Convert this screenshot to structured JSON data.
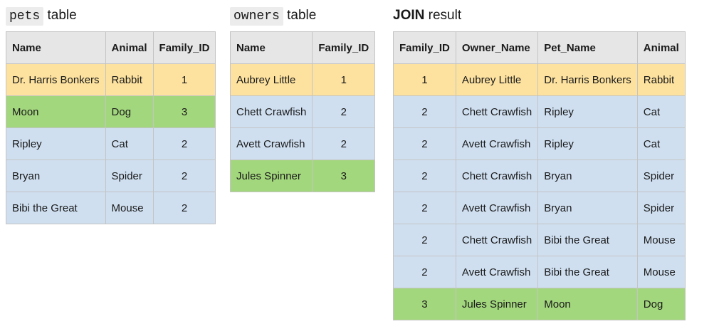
{
  "pets": {
    "title_code": "pets",
    "title_text": "table",
    "headers": [
      "Name",
      "Animal",
      "Family_ID"
    ],
    "rows": [
      {
        "color": "yellow",
        "cells": [
          "Dr. Harris Bonkers",
          "Rabbit",
          "1"
        ]
      },
      {
        "color": "green",
        "cells": [
          "Moon",
          "Dog",
          "3"
        ]
      },
      {
        "color": "blue",
        "cells": [
          "Ripley",
          "Cat",
          "2"
        ]
      },
      {
        "color": "blue",
        "cells": [
          "Bryan",
          "Spider",
          "2"
        ]
      },
      {
        "color": "blue",
        "cells": [
          "Bibi the Great",
          "Mouse",
          "2"
        ]
      }
    ]
  },
  "owners": {
    "title_code": "owners",
    "title_text": "table",
    "headers": [
      "Name",
      "Family_ID"
    ],
    "rows": [
      {
        "color": "yellow",
        "cells": [
          "Aubrey Little",
          "1"
        ]
      },
      {
        "color": "blue",
        "cells": [
          "Chett Crawfish",
          "2"
        ]
      },
      {
        "color": "blue",
        "cells": [
          "Avett Crawfish",
          "2"
        ]
      },
      {
        "color": "green",
        "cells": [
          "Jules Spinner",
          "3"
        ]
      }
    ]
  },
  "join": {
    "title_bold": "JOIN",
    "title_text": "result",
    "headers": [
      "Family_ID",
      "Owner_Name",
      "Pet_Name",
      "Animal"
    ],
    "rows": [
      {
        "color": "yellow",
        "cells": [
          "1",
          "Aubrey Little",
          "Dr. Harris Bonkers",
          "Rabbit"
        ]
      },
      {
        "color": "blue",
        "cells": [
          "2",
          "Chett Crawfish",
          "Ripley",
          "Cat"
        ]
      },
      {
        "color": "blue",
        "cells": [
          "2",
          "Avett Crawfish",
          "Ripley",
          "Cat"
        ]
      },
      {
        "color": "blue",
        "cells": [
          "2",
          "Chett Crawfish",
          "Bryan",
          "Spider"
        ]
      },
      {
        "color": "blue",
        "cells": [
          "2",
          "Avett Crawfish",
          "Bryan",
          "Spider"
        ]
      },
      {
        "color": "blue",
        "cells": [
          "2",
          "Chett Crawfish",
          "Bibi the Great",
          "Mouse"
        ]
      },
      {
        "color": "blue",
        "cells": [
          "2",
          "Avett Crawfish",
          "Bibi the Great",
          "Mouse"
        ]
      },
      {
        "color": "green",
        "cells": [
          "3",
          "Jules Spinner",
          "Moon",
          "Dog"
        ]
      }
    ]
  },
  "colors": {
    "yellow": "#fde29f",
    "green": "#a3d77d",
    "blue": "#cfdff0",
    "header": "#e6e6e6"
  }
}
